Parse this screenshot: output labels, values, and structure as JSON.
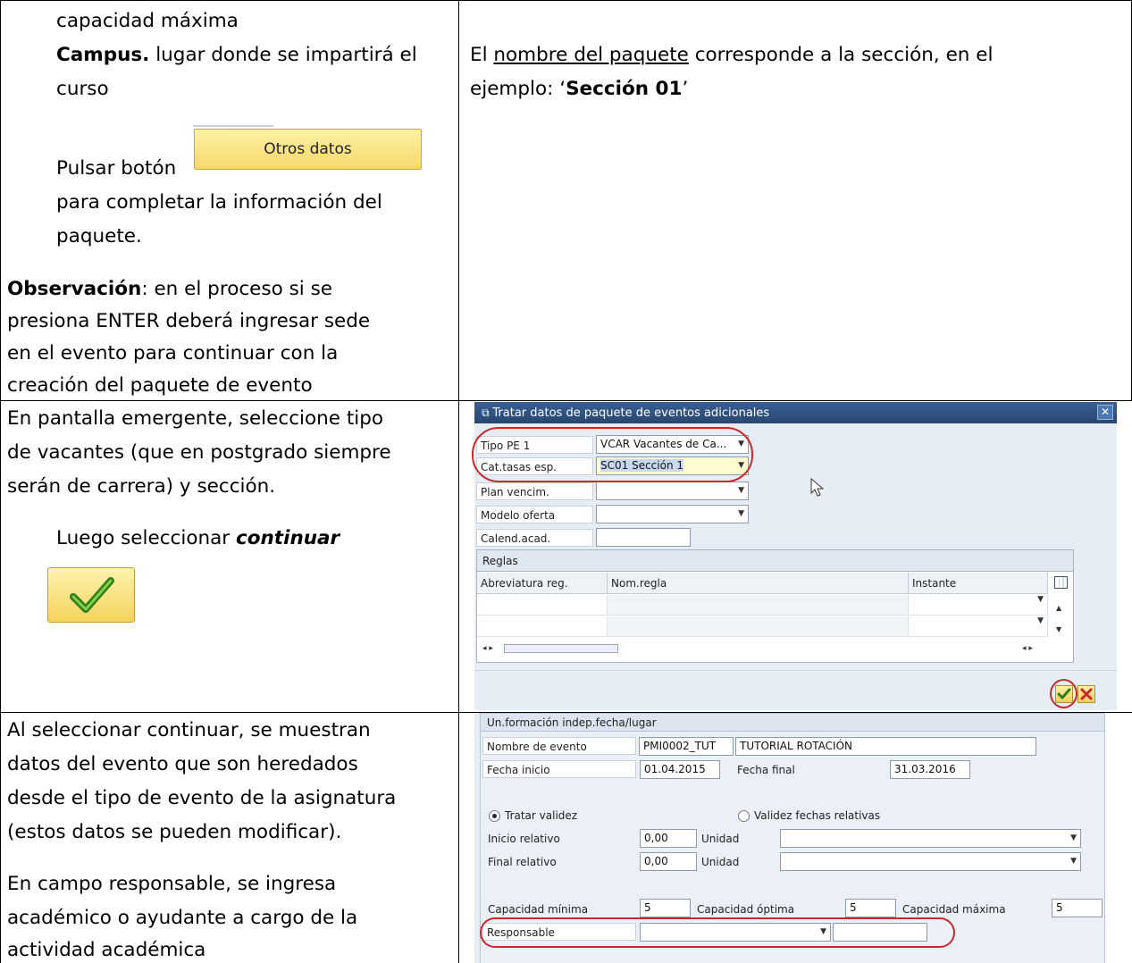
{
  "row1": {
    "left_lines": {
      "l1": "capacidad máxima",
      "campus_bold": "Campus.",
      "campus_rest": " lugar donde se impartirá el",
      "l3": "curso",
      "pulsar": "Pulsar botón",
      "l5": "para completar la información del",
      "l6": "paquete.",
      "obs_bold": "Observación",
      "obs_rest": ": en el proceso si se",
      "l8": "presiona ENTER deberá ingresar sede",
      "l9": "en el evento para continuar con la",
      "l10": "creación del paquete de evento"
    },
    "otros_button": "Otros datos",
    "right": {
      "r1_pre": "El ",
      "r1_link": "nombre del paquete",
      "r1_post": "  corresponde a la sección, en el",
      "r2_pre": "ejemplo:  ‘",
      "r2_bold": "Sección 01",
      "r2_post": "’"
    }
  },
  "row2": {
    "left_lines": {
      "l1": "En pantalla emergente, seleccione tipo",
      "l2": "de vacantes (que en postgrado siempre",
      "l3": "serán de carrera) y sección.",
      "l4_pre": "Luego seleccionar ",
      "l4_bi": "continuar"
    },
    "dialog": {
      "title": "Tratar datos de paquete de eventos adicionales",
      "fields": {
        "tipo_label": "Tipo PE 1",
        "tipo_value": "VCAR Vacantes de Ca...",
        "cat_label": "Cat.tasas esp.",
        "cat_value": "SC01 Sección 1",
        "plan_label": "Plan vencim.",
        "plan_value": "",
        "modelo_label": "Modelo oferta",
        "modelo_value": "",
        "calend_label": "Calend.acad.",
        "calend_value": ""
      },
      "grid": {
        "header": "Reglas",
        "col1": "Abreviatura reg.",
        "col2": "Nom.regla",
        "col3": "Instante"
      }
    }
  },
  "row3": {
    "left_lines": {
      "l1": "Al seleccionar continuar, se muestran",
      "l2": "datos del evento que  son heredados",
      "l3": "desde el tipo de evento de la asignatura",
      "l4": "(estos datos se pueden modificar).",
      "l5": "En campo responsable, se ingresa",
      "l6": "académico o ayudante a cargo de la",
      "l7": "actividad académica"
    },
    "screen": {
      "header": "Un.formación indep.fecha/lugar",
      "nombre_label": "Nombre de evento",
      "nombre_code": "PMI0002_TUT",
      "nombre_text": "TUTORIAL ROTACIÓN",
      "fecha_inicio_label": "Fecha inicio",
      "fecha_inicio": "01.04.2015",
      "fecha_final_label": "Fecha final",
      "fecha_final": "31.03.2016",
      "radio1": "Tratar validez",
      "radio2": "Validez fechas relativas",
      "inicio_rel_label": "Inicio relativo",
      "inicio_rel": "0,00",
      "final_rel_label": "Final relativo",
      "final_rel": "0,00",
      "unidad_label": "Unidad",
      "cap_min_label": "Capacidad mínima",
      "cap_min": "5",
      "cap_opt_label": "Capacidad óptima",
      "cap_opt": "5",
      "cap_max_label": "Capacidad máxima",
      "cap_max": "5",
      "resp_label": "Responsable",
      "resp_value": ""
    }
  }
}
